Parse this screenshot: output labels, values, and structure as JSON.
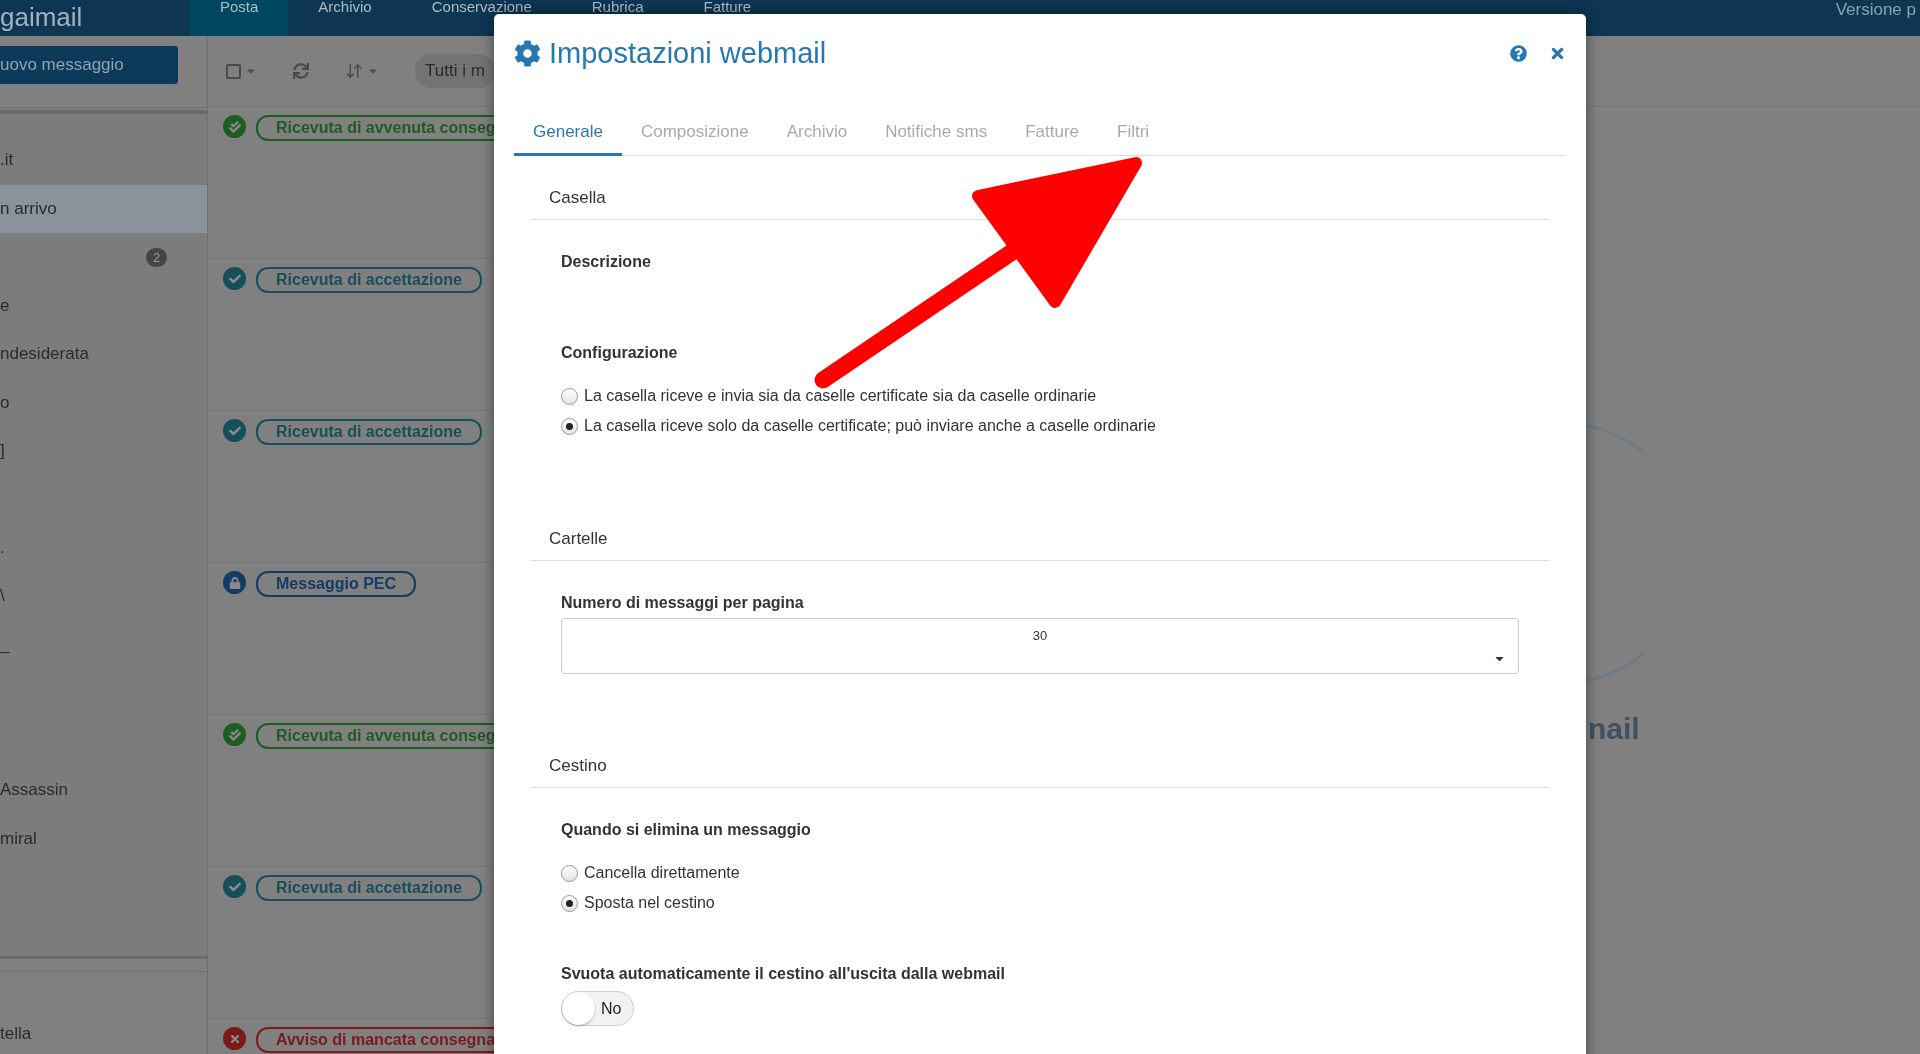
{
  "nav": {
    "logo": "gaimail",
    "tabs": [
      {
        "label": "Posta",
        "selected": true
      },
      {
        "label": "Archivio",
        "selected": false
      },
      {
        "label": "Conservazione",
        "selected": false
      },
      {
        "label": "Rubrica",
        "selected": false
      },
      {
        "label": "Fatture",
        "selected": false
      }
    ],
    "version": "Versione p"
  },
  "sidebar": {
    "new_message_button": "uovo messaggio",
    "groups": [
      [
        {
          "label": ".it",
          "selected": false
        },
        {
          "label": "n arrivo",
          "selected": true
        },
        {
          "badge": "2",
          "selected": false
        },
        {
          "label": "e",
          "selected": false
        },
        {
          "label": "ndesiderata",
          "selected": false
        },
        {
          "label": "o",
          "selected": false
        },
        {
          "label": "]",
          "selected": false
        }
      ],
      [
        {
          "label": ".",
          "selected": false
        },
        {
          "label": "\\",
          "selected": false
        },
        {
          "label": "_",
          "selected": false
        }
      ],
      [
        {
          "label": "Assassin",
          "selected": false
        },
        {
          "label": "miral",
          "selected": false
        }
      ]
    ],
    "footer": "tella"
  },
  "message_list": {
    "filter": "Tutti i m",
    "messages": [
      {
        "kind": "delivered",
        "status": "Ricevuta di avvenuta conseg",
        "color": "#1f5c1f"
      },
      {
        "kind": "accepted",
        "status": "Ricevuta di accettazione",
        "color": "#164f5a"
      },
      {
        "kind": "accepted",
        "status": "Ricevuta di accettazione",
        "color": "#164f5a"
      },
      {
        "kind": "pec",
        "status": "Messaggio PEC",
        "color": "#143a66"
      },
      {
        "kind": "delivered",
        "status": "Ricevuta di avvenuta conseg",
        "color": "#1f5c1f"
      },
      {
        "kind": "accepted",
        "status": "Ricevuta di accettazione",
        "color": "#164f5a"
      },
      {
        "kind": "failed",
        "status": "Avviso di mancata consegna",
        "color": "#7a1a1a"
      }
    ]
  },
  "background_logo_text": "nail",
  "dialog": {
    "title": "Impostazioni webmail",
    "tabs": [
      {
        "label": "Generale",
        "selected": true
      },
      {
        "label": "Composizione",
        "selected": false
      },
      {
        "label": "Archivio",
        "selected": false
      },
      {
        "label": "Notifiche sms",
        "selected": false
      },
      {
        "label": "Fatture",
        "selected": false
      },
      {
        "label": "Filtri",
        "selected": false
      }
    ],
    "sections": [
      {
        "title": "Casella",
        "fields": [
          {
            "kind": "label",
            "label": "Descrizione"
          },
          {
            "kind": "radios",
            "label": "Configurazione",
            "options": [
              {
                "label": "La casella riceve e invia sia da caselle certificate sia da caselle ordinarie",
                "selected": false
              },
              {
                "label": "La casella riceve solo da caselle certificate; può inviare anche a caselle ordinarie",
                "selected": true
              }
            ]
          }
        ]
      },
      {
        "title": "Cartelle",
        "fields": [
          {
            "kind": "select",
            "label": "Numero di messaggi per pagina",
            "value": "30"
          }
        ]
      },
      {
        "title": "Cestino",
        "fields": [
          {
            "kind": "radios",
            "label": "Quando si elimina un messaggio",
            "options": [
              {
                "label": "Cancella direttamente",
                "selected": false
              },
              {
                "label": "Sposta nel cestino",
                "selected": true
              }
            ]
          },
          {
            "kind": "toggle",
            "label": "Svuota automaticamente il cestino all'uscita dalla webmail",
            "on": false,
            "text": "No"
          }
        ]
      }
    ]
  }
}
